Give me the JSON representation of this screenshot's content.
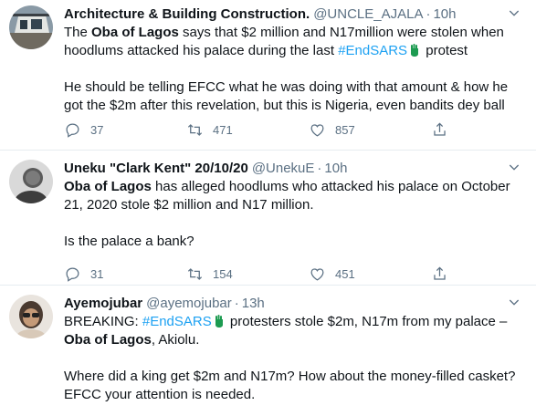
{
  "tweets": [
    {
      "name": "Architecture & Building Construction.",
      "handle": "@UNCLE_AJALA",
      "dot": "·",
      "time": "10h",
      "p1_a": "The ",
      "p1_b": "Oba of Lagos",
      "p1_c": " says that $2 million and N17million were stolen when hoodlums attacked his palace during the last ",
      "p1_tag": "#EndSARS",
      "p1_d": " protest",
      "p2": "He should be telling EFCC what he was doing with that amount & how he got the $2m after this revelation, but this is Nigeria, even bandits dey ball",
      "replies": "37",
      "retweets": "471",
      "likes": "857"
    },
    {
      "name": "Uneku \"Clark Kent\" 20/10/20",
      "handle": "@UnekuE",
      "dot": "·",
      "time": "10h",
      "p1_b": "Oba of Lagos",
      "p1_c": " has alleged hoodlums who attacked his palace on October 21, 2020 stole $2 million and N17 million.",
      "p2": "Is the palace a bank?",
      "replies": "31",
      "retweets": "154",
      "likes": "451"
    },
    {
      "name": "Ayemojubar",
      "handle": "@ayemojubar",
      "dot": "·",
      "time": "13h",
      "p1_a": "BREAKING: ",
      "p1_tag": "#EndSARS",
      "p1_c": " protesters stole $2m, N17m from my palace – ",
      "p1_b": "Oba of Lagos",
      "p1_d": ", Akiolu.",
      "p2": "Where did a king get $2m and N17m? How about the money-filled casket? EFCC your attention is needed."
    }
  ],
  "icons": {
    "reply": "reply-icon",
    "retweet": "retweet-icon",
    "like": "heart-icon",
    "share": "share-icon",
    "more": "chevron-down-icon"
  },
  "colors": {
    "link": "#1da1f2",
    "secondary": "#5b7083",
    "text": "#0f1419",
    "divider": "#e6ecf0",
    "flag": "#1d9b51"
  }
}
